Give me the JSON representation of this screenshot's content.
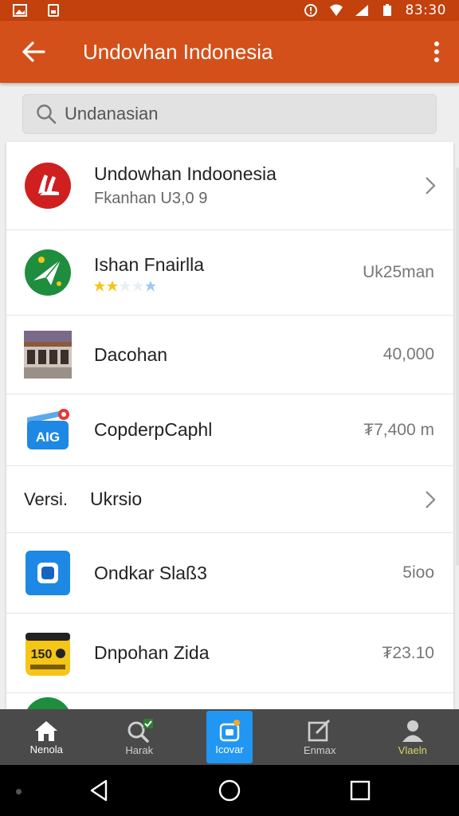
{
  "status_bar": {
    "time": "83:30"
  },
  "app_bar": {
    "title": "Undovhan Indonesia"
  },
  "search": {
    "placeholder": "Undanasian"
  },
  "list": [
    {
      "title": "Undowhan Indoonesia",
      "subtitle": "Fkanhan U3,0 9",
      "trailing": "chevron",
      "icon": "brand-logo-red"
    },
    {
      "title": "Ishan Fnairlla",
      "rating": 2,
      "max_rating": 5,
      "value": "Uk25man",
      "icon": "paper-plane-green"
    },
    {
      "title": "Dacohan",
      "value": "40,000",
      "icon": "building-photo"
    },
    {
      "title": "CopderpCaphl",
      "value": "₮7,400 m",
      "icon": "blue-badge-app"
    },
    {
      "label": "Versi.",
      "title": "Ukrsio",
      "trailing": "chevron"
    },
    {
      "title": "Ondkar Slaß3",
      "value": "5ioo",
      "icon": "blue-square-app"
    },
    {
      "title": "Dnpohan Zida",
      "value": "₮23.10",
      "icon": "yellow-tile-app"
    }
  ],
  "bottom_nav": [
    {
      "label": "Nenola",
      "icon": "home-icon"
    },
    {
      "label": "Harak",
      "icon": "search-icon"
    },
    {
      "label": "Icovar",
      "icon": "tile-icon"
    },
    {
      "label": "Enmax",
      "icon": "edit-icon"
    },
    {
      "label": "Vlaeln",
      "icon": "profile-icon"
    }
  ],
  "colors": {
    "status_bar": "#c2410c",
    "app_bar": "#d4501a",
    "active_tab": "#2196f3",
    "nav_bg": "#4a4a4a"
  }
}
